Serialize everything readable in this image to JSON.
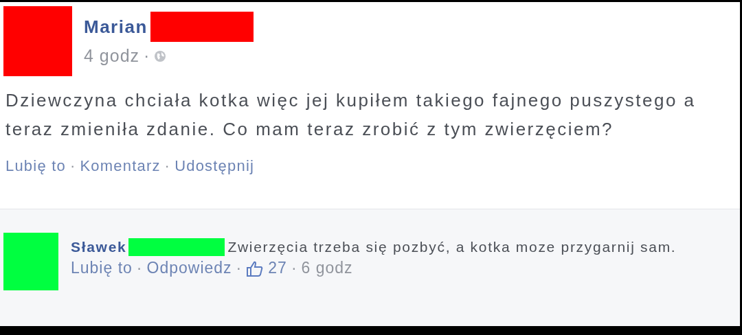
{
  "post": {
    "author": "Marian",
    "color": "#ff0000",
    "time": "4 godz",
    "privacy_separator": "·",
    "text": "Dziewczyna chciała kotka więc jej kupiłem takiego fajnego puszystego a teraz zmieniła zdanie. Co mam teraz zrobić z tym zwierzęciem?",
    "actions": [
      {
        "label": "Lubię to"
      },
      {
        "separator": "·",
        "label": "Komentarz"
      },
      {
        "separator": "·",
        "label": "Udostępnij"
      }
    ]
  },
  "comment": {
    "author": "Sławek",
    "color": "#00ff40",
    "text": "Zwierzęcia trzeba się pozbyć, a kotka moze przygarnij sam.",
    "footer": [
      {
        "kind": "link",
        "label": "Lubię to"
      },
      {
        "kind": "link",
        "separator": "·",
        "label": "Odpowiedz"
      },
      {
        "kind": "likes",
        "separator": "·",
        "label": "27"
      },
      {
        "kind": "time",
        "separator": "·",
        "label": "6 godz"
      }
    ]
  }
}
